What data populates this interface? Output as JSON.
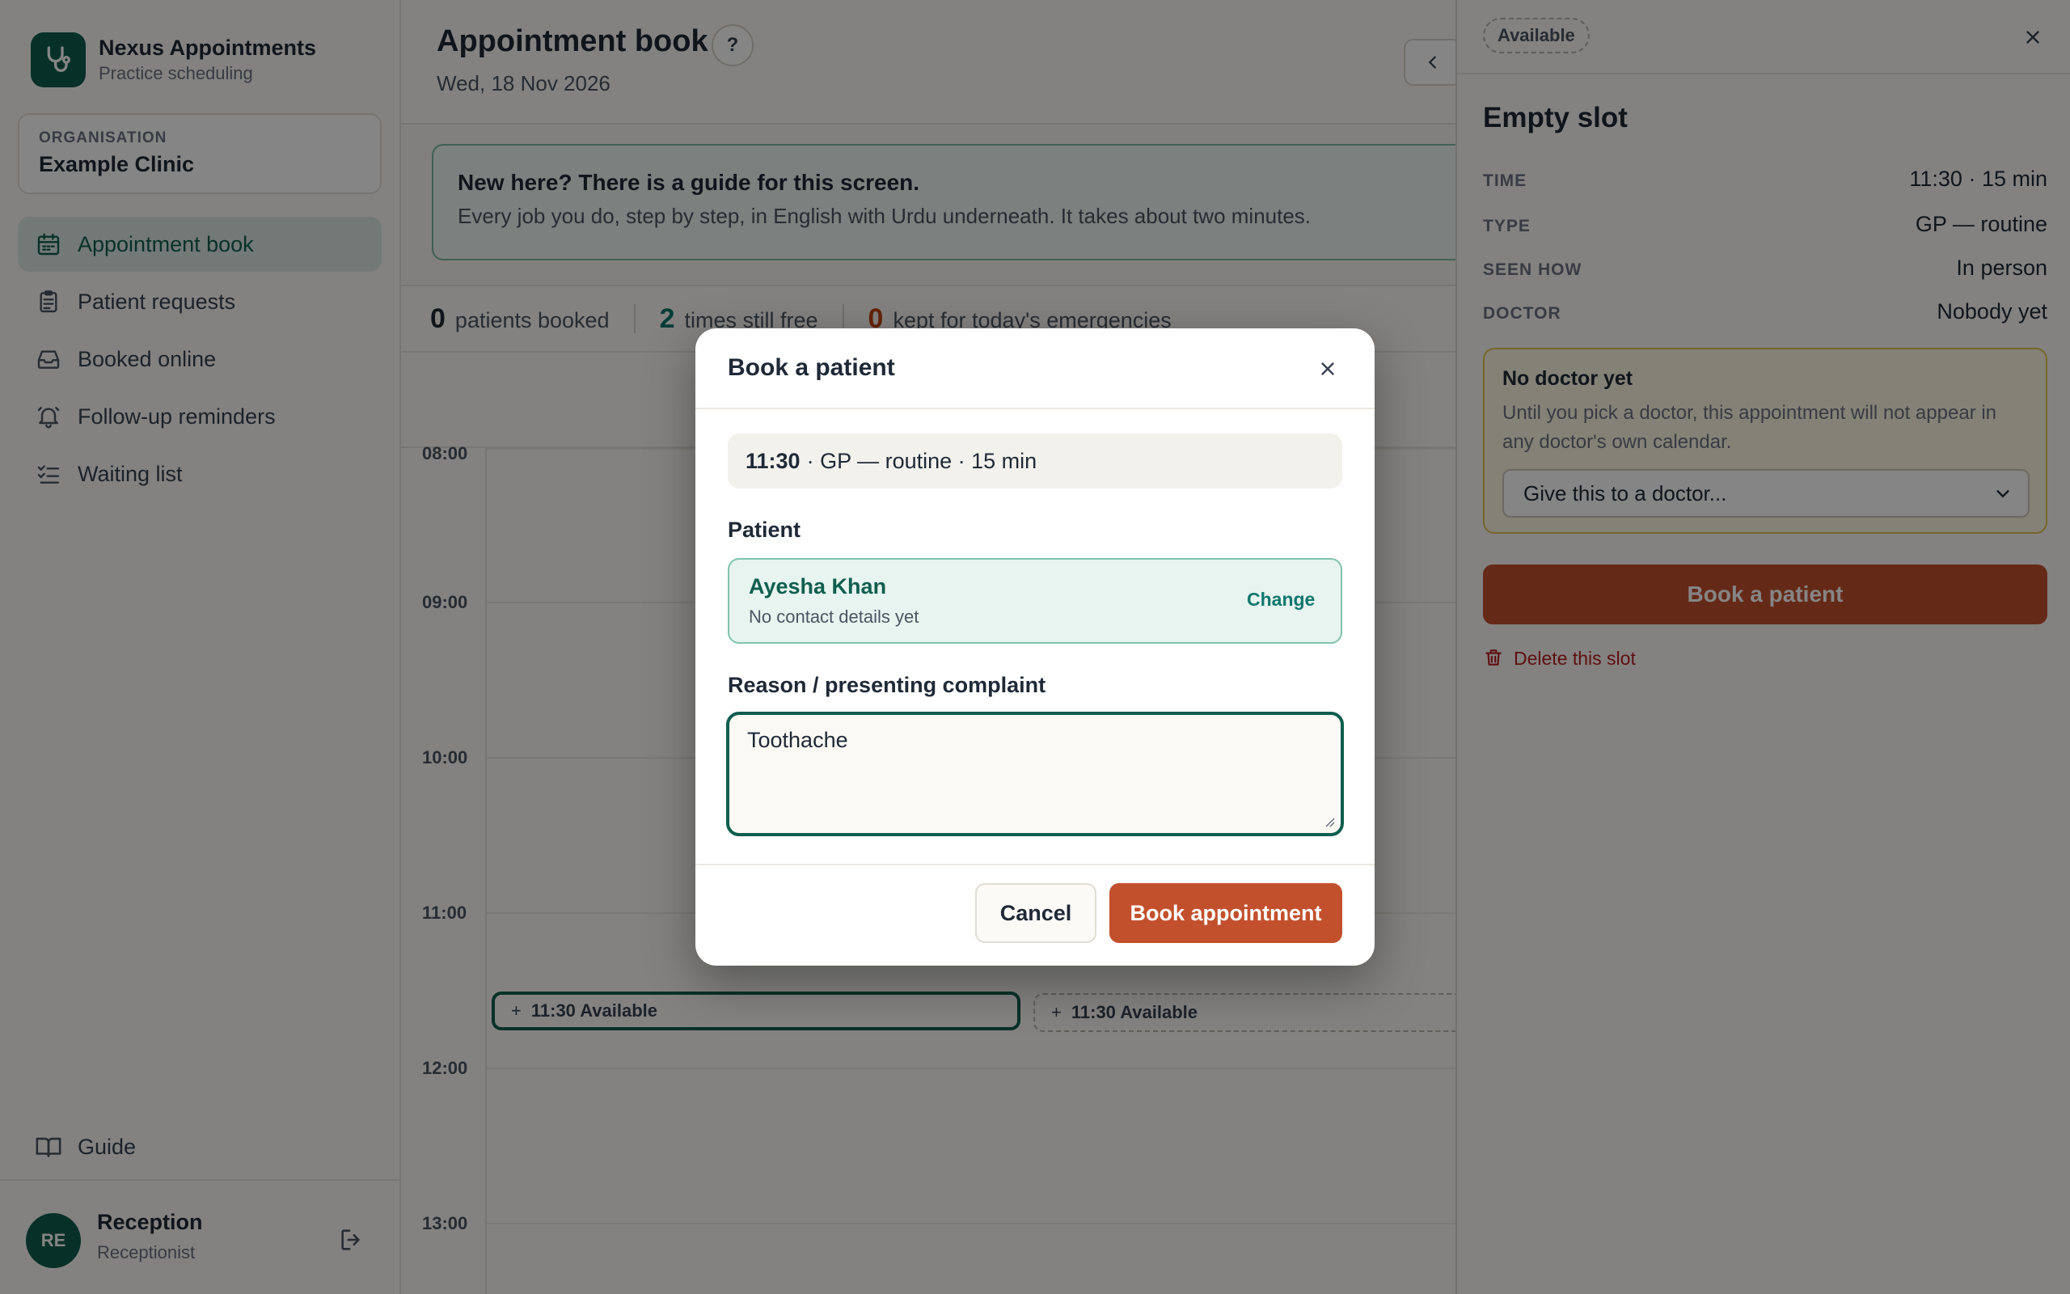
{
  "app": {
    "name": "Nexus Appointments",
    "subtitle": "Practice scheduling"
  },
  "organisation": {
    "label": "ORGANISATION",
    "name": "Example Clinic"
  },
  "nav": {
    "items": [
      {
        "label": "Appointment book",
        "icon": "calendar-icon",
        "active": true
      },
      {
        "label": "Patient requests",
        "icon": "clipboard-icon",
        "active": false
      },
      {
        "label": "Booked online",
        "icon": "inbox-icon",
        "active": false
      },
      {
        "label": "Follow-up reminders",
        "icon": "bell-icon",
        "active": false
      },
      {
        "label": "Waiting list",
        "icon": "checklist-icon",
        "active": false
      }
    ],
    "guide_label": "Guide"
  },
  "user": {
    "initials": "RE",
    "name": "Reception",
    "role": "Receptionist"
  },
  "page": {
    "title": "Appointment book",
    "help": "?",
    "date": "Wed, 18 Nov 2026"
  },
  "guide_banner": {
    "title": "New here? There is a guide for this screen.",
    "text": "Every job you do, step by step, in English with Urdu underneath. It takes about two minutes."
  },
  "stats": {
    "booked_count": "0",
    "booked_label": "patients booked",
    "free_count": "2",
    "free_label": "times still free",
    "emergency_count": "0",
    "emergency_label": "kept for today's emergencies"
  },
  "calendar": {
    "times": [
      "08:00",
      "09:00",
      "10:00",
      "11:00",
      "12:00",
      "13:00"
    ],
    "slots": [
      {
        "label": "11:30 Available",
        "selected": true
      },
      {
        "label": "11:30 Available",
        "selected": false
      }
    ]
  },
  "panel": {
    "status": "Available",
    "title": "Empty slot",
    "details": [
      {
        "key": "TIME",
        "value": "11:30 · 15 min"
      },
      {
        "key": "TYPE",
        "value": "GP — routine"
      },
      {
        "key": "SEEN HOW",
        "value": "In person"
      },
      {
        "key": "DOCTOR",
        "value": "Nobody yet"
      }
    ],
    "warning": {
      "title": "No doctor yet",
      "text": "Until you pick a doctor, this appointment will not appear in any doctor's own calendar.",
      "select_value": "Give this to a doctor..."
    },
    "book_button": "Book a patient",
    "delete_link": "Delete this slot"
  },
  "modal": {
    "title": "Book a patient",
    "summary_time": "11:30",
    "summary_rest": "· GP — routine · 15 min",
    "patient_label": "Patient",
    "patient_name": "Ayesha Khan",
    "patient_sub": "No contact details yet",
    "change_label": "Change",
    "reason_label": "Reason / presenting complaint",
    "reason_value": "Toothache",
    "cancel_label": "Cancel",
    "confirm_label": "Book appointment"
  },
  "colors": {
    "brand": "#0f5e4e",
    "accent_button": "#c2502d",
    "warning_border": "#e6c453",
    "danger": "#b91c1c"
  }
}
